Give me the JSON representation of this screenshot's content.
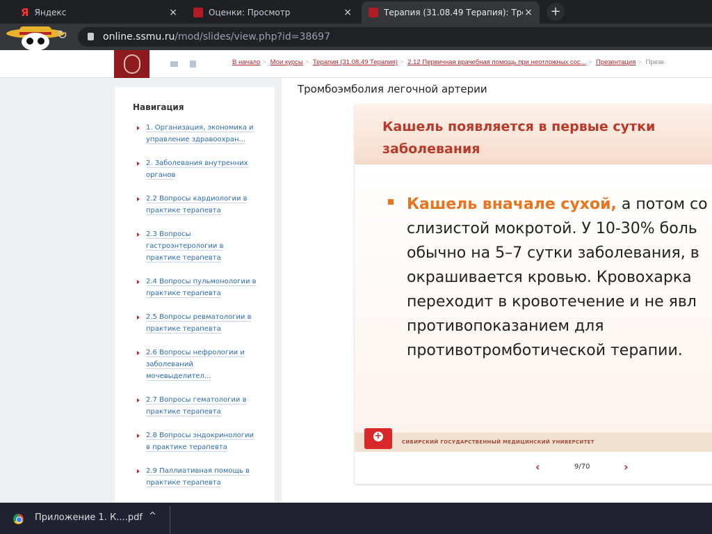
{
  "browser": {
    "tabs": [
      {
        "label": "Яндекс",
        "icon": "yandex-icon"
      },
      {
        "label": "Оценки: Просмотр",
        "icon": "ssmu-icon"
      },
      {
        "label": "Терапия (31.08.49 Терапия): Тро",
        "icon": "ssmu-icon",
        "active": true
      }
    ],
    "new_tab": "+",
    "close": "×",
    "url_host": "online.ssmu.ru",
    "url_path": "/mod/slides/view.php?id=38697"
  },
  "breadcrumb": [
    "В начало",
    "Мои курсы",
    "Терапия (31.08.49 Терапия)",
    "2.12 Первичная врачебная помощь при неотложных сос...",
    "Презентация",
    "Презе"
  ],
  "breadcrumb_sep": ">",
  "sidebar": {
    "title": "Навигация",
    "items": [
      "1. Организация, экономика и управление здравоохран...",
      "2. Заболевания внутренних органов",
      "2.2 Вопросы кардиологии в практике терапевта",
      "2.3 Вопросы гастроэнтерологии в практике терапевта",
      "2.4 Вопросы пульмонологии в практике терапевта",
      "2.5 Вопросы ревматологии в практике терапевта",
      "2.6 Вопросы нефрологии и заболеваний мочевыделител...",
      "2.7 Вопросы гематологии в практике терапевта",
      "2.8 Вопросы эндокринологии в практике терапевта",
      "2.9 Паллиативная помощь в практике терапевта"
    ]
  },
  "page_title": "Тромбоэмболия легочной артерии",
  "slide": {
    "title_lines": [
      "Кашель появляется в первые сутки",
      "заболевания"
    ],
    "highlight": "Кашель вначале сухой,",
    "lines": [
      " а потом со",
      "слизистой мокротой. У 10-30% боль",
      "обычно на 5–7 сутки заболевания, в",
      "окрашивается кровью. Кровохарка",
      "переходит в кровотечение и не явл",
      "противопоказанием  для",
      "противотромботической терапии."
    ],
    "footer": "СИБИРСКИЙ ГОСУДАРСТВЕННЫЙ МЕДИЦИНСКИЙ УНИВЕРСИТЕТ"
  },
  "slide_nav": {
    "prev": "‹",
    "next": "›",
    "page": "9/70",
    "current": 9,
    "total": 70
  },
  "download_bar": {
    "file": "Приложение 1. К....pdf",
    "caret": "^"
  },
  "colors": {
    "brand": "#8e1b1e",
    "accent": "#e8741e",
    "link": "#2a6bb0"
  }
}
